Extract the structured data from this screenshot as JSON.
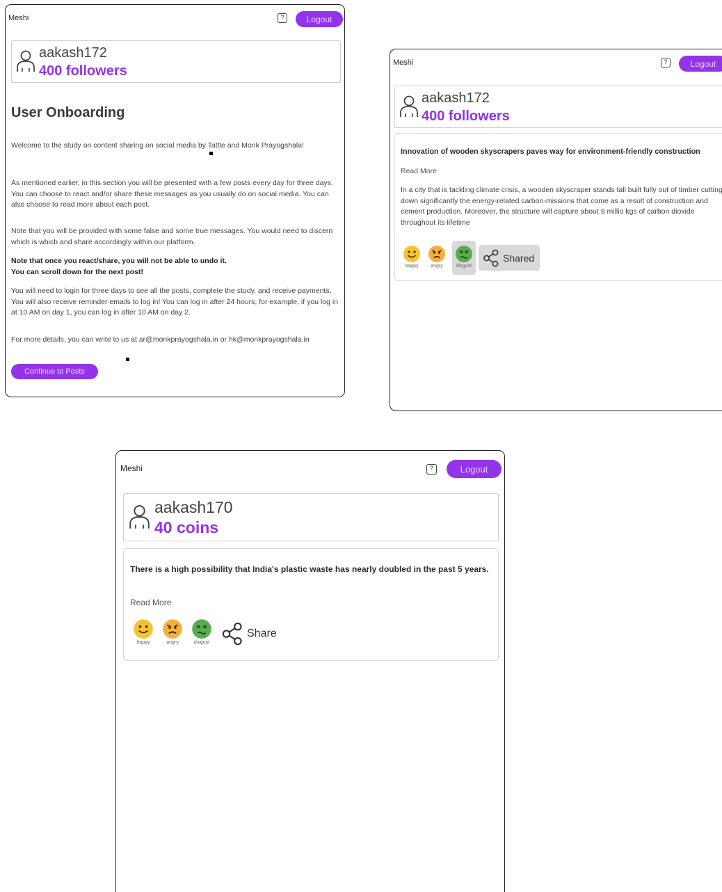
{
  "screens": [
    {
      "app_name": "Meshi",
      "help_glyph": "?",
      "logout_label": "Logout",
      "profile": {
        "username": "aakash172",
        "stat": "400 followers"
      },
      "onboarding": {
        "title": "User Onboarding",
        "paragraphs": [
          "Welcome to the study on content sharing on social media by Tattle and Monk Prayogshala!",
          "As mentioned earlier, in this section you will be presented with a few posts every day for three days. You can choose to react and/or share these messages as you usually do on social media. You can also choose to read more about each post.",
          "Note that you will be provided with some false and some true messages. You would need to discern which is which and share accordingly within our platform.",
          "Note that once you react/share, you will not be able to undo it.",
          "You can scroll down for the next post!",
          "You will need to login for three days to see all the posts, complete the study, and receive payments. You will also receive reminder emails to log in! You can log in after 24 hours; for example, if you log in at 10 AM on day 1, you can log in after 10 AM on day 2.",
          "For more details, you can write to us at ar@monkprayogshala.in or hk@monkprayogshala.in"
        ],
        "continue_label": "Continue to Posts"
      }
    },
    {
      "app_name": "Meshi",
      "help_glyph": "?",
      "logout_label": "Logout",
      "profile": {
        "username": "aakash172",
        "stat": "400 followers"
      },
      "post": {
        "headline": "Innovation of wooden skyscrapers paves way for environment-friendly construction",
        "read_more": "Read More",
        "body": "In a city that is tackling climate crisis, a wooden skyscraper stands tall built fully out of timber cutting down significantly the energy-related carbon-missions that come as a result of construction and cement production. Moreover, the structure will capture about 9 millio kgs of carbon dioxide throughout its lifetime",
        "reactions": [
          "happy",
          "angry",
          "disgust"
        ],
        "share_label": "Shared"
      }
    },
    {
      "app_name": "Meshi",
      "help_glyph": "?",
      "logout_label": "Logout",
      "profile": {
        "username": "aakash170",
        "stat": "40 coins"
      },
      "post": {
        "headline": "There is a high possibility that India's plastic waste has nearly doubled in the past 5 years.",
        "read_more": "Read More",
        "reactions": [
          "happy",
          "angry",
          "disgust"
        ],
        "share_label": "Share"
      }
    }
  ],
  "colors": {
    "accent": "#9333ea",
    "happy": "#f6c431",
    "angry": "#f3b23c",
    "disgust": "#5aac4f",
    "selected_bg": "#d9d9d9"
  },
  "icons": [
    "help-icon",
    "user-icon",
    "happy-emoji-icon",
    "angry-emoji-icon",
    "disgust-emoji-icon",
    "share-icon"
  ]
}
